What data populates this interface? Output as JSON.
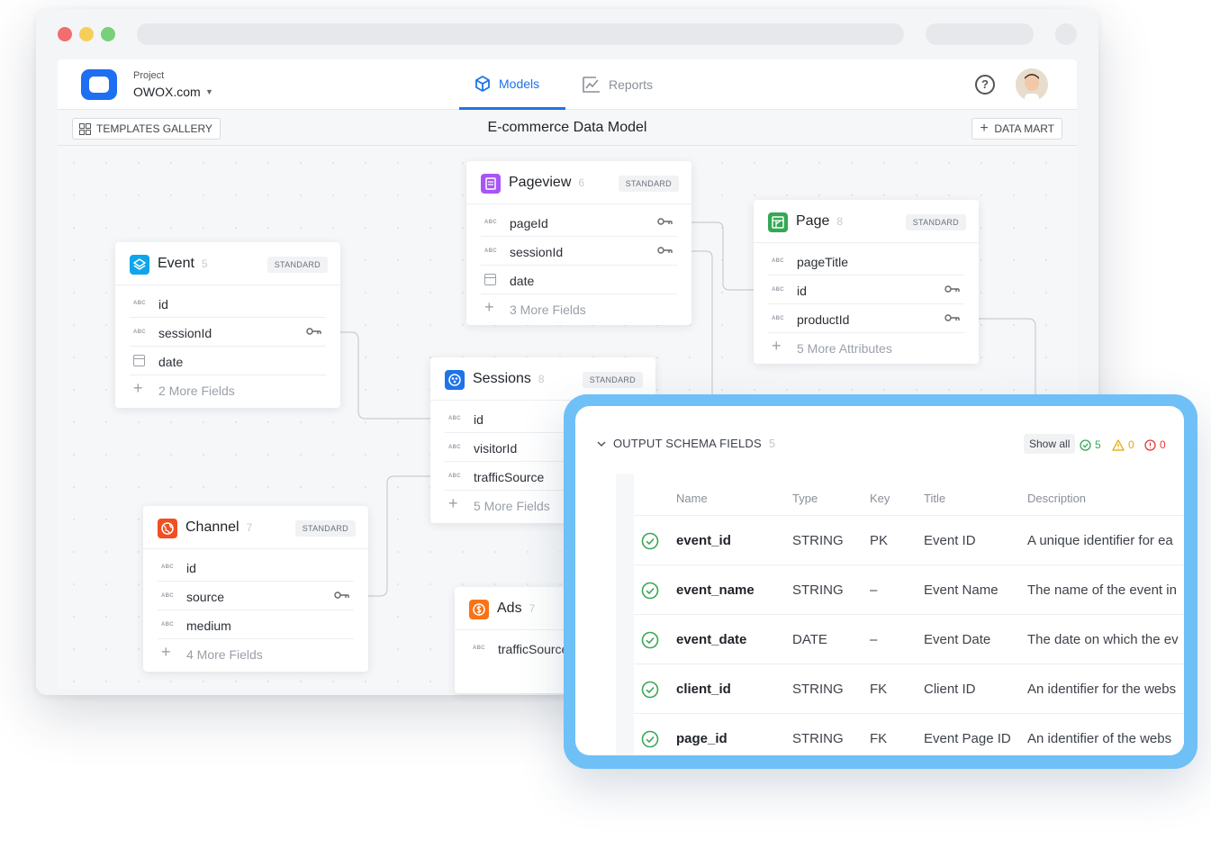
{
  "header": {
    "project_label": "Project",
    "project_name": "OWOX.com",
    "tabs": [
      {
        "label": "Models",
        "active": true
      },
      {
        "label": "Reports",
        "active": false
      }
    ]
  },
  "toolbar": {
    "templates_label": "TEMPLATES GALLERY",
    "model_title": "E-commerce Data Model",
    "data_mart_label": "DATA MART"
  },
  "entities": {
    "pageview": {
      "name": "Pageview",
      "count": "6",
      "badge": "STANDARD",
      "icon": "document-icon",
      "color": "#a855f7",
      "fields": [
        "pageId",
        "sessionId",
        "date"
      ],
      "more": "3 More Fields"
    },
    "page": {
      "name": "Page",
      "count": "8",
      "badge": "STANDARD",
      "icon": "sheet-icon",
      "color": "#34a853",
      "fields": [
        "pageTitle",
        "id",
        "productId"
      ],
      "more": "5 More Attributes"
    },
    "event": {
      "name": "Event",
      "count": "5",
      "badge": "STANDARD",
      "icon": "layers-icon",
      "color": "#0ea5e9",
      "fields": [
        "id",
        "sessionId",
        "date"
      ],
      "more": "2 More Fields"
    },
    "sessions": {
      "name": "Sessions",
      "count": "8",
      "badge": "STANDARD",
      "icon": "sessions-icon",
      "color": "#1e73e8",
      "fields": [
        "id",
        "visitorId",
        "trafficSource"
      ],
      "more": "5 More Fields"
    },
    "channel": {
      "name": "Channel",
      "count": "7",
      "badge": "STANDARD",
      "icon": "globe-icon",
      "color": "#f04e23",
      "fields": [
        "id",
        "source",
        "medium"
      ],
      "more": "4 More Fields"
    },
    "ads": {
      "name": "Ads",
      "count": "7",
      "icon": "dollar-icon",
      "color": "#f97316",
      "fields": [
        "trafficSource"
      ]
    }
  },
  "schema_panel": {
    "title": "OUTPUT SCHEMA FIELDS",
    "count": "5",
    "show_all": "Show all",
    "stats": {
      "ok": "5",
      "warn": "0",
      "error": "0"
    },
    "columns": [
      "Name",
      "Type",
      "Key",
      "Title",
      "Description"
    ],
    "rows": [
      {
        "name": "event_id",
        "type": "STRING",
        "key": "PK",
        "title": "Event ID",
        "description": "A unique identifier for ea"
      },
      {
        "name": "event_name",
        "type": "STRING",
        "key": "–",
        "title": "Event Name",
        "description": "The name of the event in"
      },
      {
        "name": "event_date",
        "type": "DATE",
        "key": "–",
        "title": "Event Date",
        "description": "The date on which the ev"
      },
      {
        "name": "client_id",
        "type": "STRING",
        "key": "FK",
        "title": "Client ID",
        "description": "An identifier for the webs"
      },
      {
        "name": "page_id",
        "type": "STRING",
        "key": "FK",
        "title": "Event Page ID",
        "description": "An identifier of the webs"
      }
    ]
  }
}
